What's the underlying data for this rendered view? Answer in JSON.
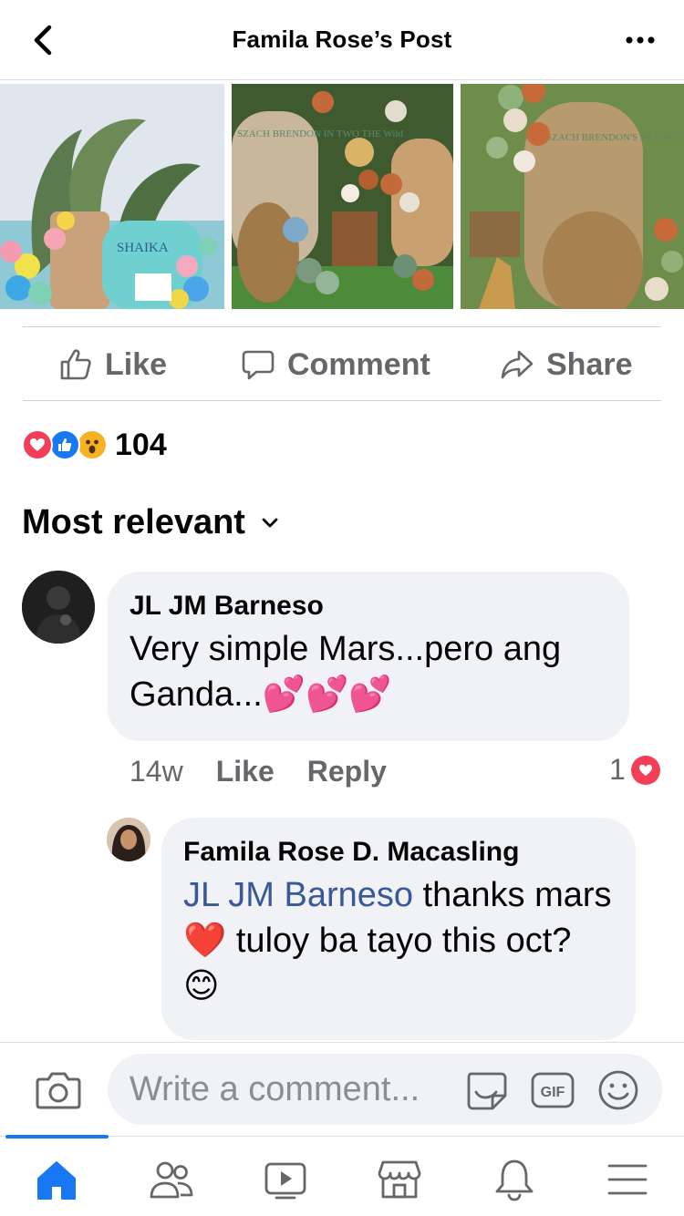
{
  "header": {
    "title": "Famila Rose’s Post",
    "back_icon": "chevron-left-icon",
    "more_icon": "more-horizontal-icon"
  },
  "photos": [
    {
      "sign_text": "SHAIKA"
    },
    {
      "sign_text": "SZACH BRENDON IN TWO THE Wild"
    },
    {
      "sign_text": "SZACH BRENDON'S IN TWO THE Wild"
    }
  ],
  "actions": {
    "like_label": "Like",
    "comment_label": "Comment",
    "share_label": "Share"
  },
  "reactions": {
    "types": [
      "love",
      "like",
      "wow"
    ],
    "count": "104"
  },
  "sort": {
    "label": "Most relevant"
  },
  "comments": [
    {
      "author": "JL JM Barneso",
      "text": "Very simple Mars...pero ang Ganda...💕💕💕",
      "time": "14w",
      "like_label": "Like",
      "reply_label": "Reply",
      "reaction_count": "1",
      "reaction_type": "love"
    }
  ],
  "reply": {
    "author": "Famila Rose D. Macasling",
    "mention": "JL JM Barneso",
    "text": " thanks mars❤️ tuloy ba tayo this oct? 😊"
  },
  "composer": {
    "placeholder": "Write a comment...",
    "gif_label": "GIF"
  },
  "colors": {
    "accent": "#1877f2",
    "mention": "#385898",
    "love": "#f33e58",
    "wow": "#f7b125",
    "bubble": "#f0f2f5",
    "secondary_text": "#65676b"
  },
  "nav": [
    "home-icon",
    "friends-icon",
    "watch-icon",
    "marketplace-icon",
    "notifications-icon",
    "menu-icon"
  ]
}
